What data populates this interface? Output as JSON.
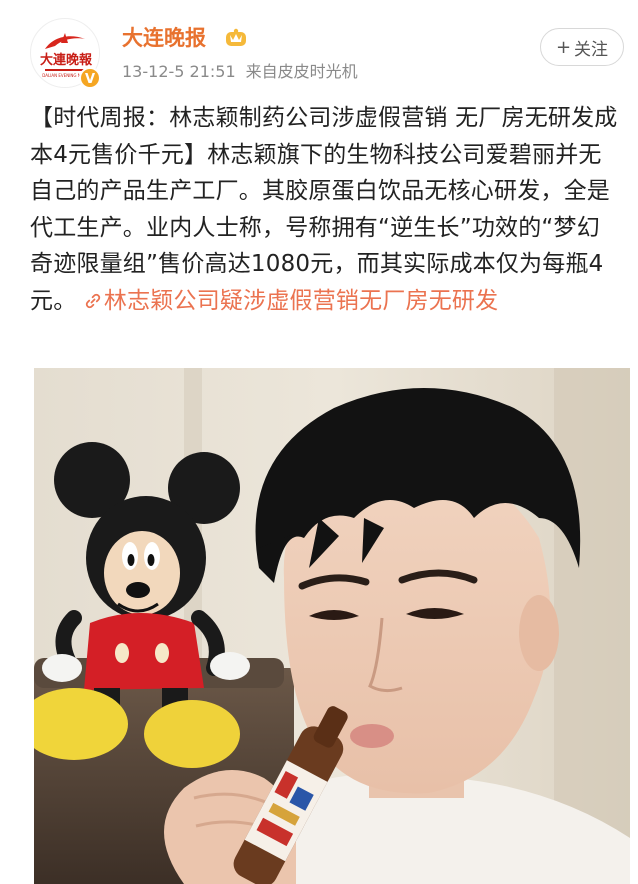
{
  "account": {
    "name": "大连晚报",
    "avatar_text": "大連晚報",
    "avatar_icon": "newspaper-logo",
    "verified_icon": "verified-badge-icon",
    "vip_icon": "vip-crown-icon"
  },
  "meta": {
    "date": "13-12-5 21:51",
    "source": "来自皮皮时光机"
  },
  "follow": {
    "icon": "plus-icon",
    "plus": "+",
    "label": "关注"
  },
  "post": {
    "headline": "【时代周报：林志颖制药公司涉虚假营销 无厂房无研发成本4元售价千元】",
    "body": "林志颖旗下的生物科技公司爱碧丽并无自己的产品生产工厂。其胶原蛋白饮品无核心研发，全是代工生产。业内人士称，号称拥有“逆生长”功效的“梦幻奇迹限量组”售价高达1080元，而其实际成本仅为每瓶4元。",
    "link_icon": "link-icon",
    "link_text": "林志颖公司疑涉虚假营销无厂房无研发"
  },
  "colors": {
    "account_name": "#e8722f",
    "link": "#eb7350",
    "meta": "#8a8a8a",
    "badge": "#f5a623"
  },
  "photo": {
    "description_icon": "photo-image"
  }
}
